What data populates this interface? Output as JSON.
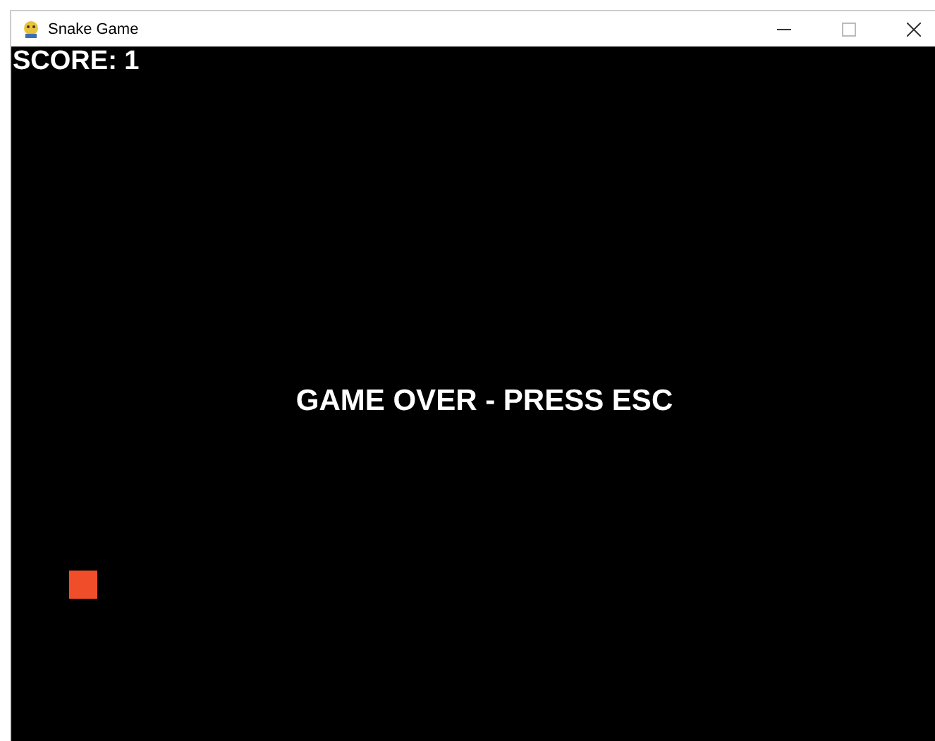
{
  "window": {
    "title": "Snake Game"
  },
  "game": {
    "score_label": "SCORE: 1",
    "message": "GAME OVER - PRESS ESC",
    "food": {
      "color": "#f04e2a"
    }
  }
}
